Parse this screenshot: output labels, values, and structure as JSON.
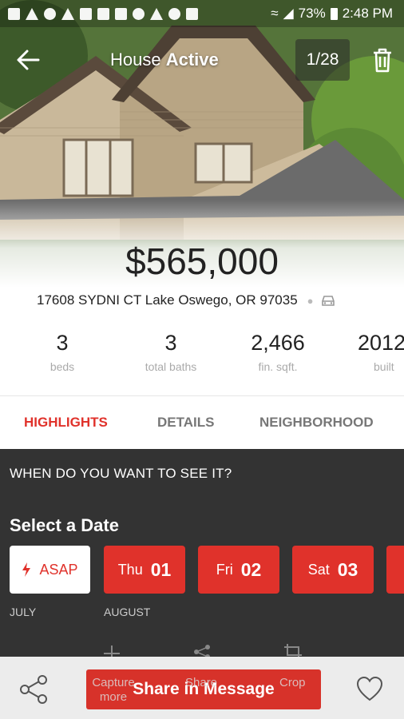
{
  "status_bar": {
    "battery": "73%",
    "time": "2:48 PM"
  },
  "header": {
    "title_prefix": "House",
    "title_status": "Active",
    "photo_counter": "1/28"
  },
  "listing": {
    "price": "$565,000",
    "address": "17608 SYDNI CT  Lake Oswego, OR 97035",
    "stats": [
      {
        "value": "3",
        "label": "beds"
      },
      {
        "value": "3",
        "label": "total baths"
      },
      {
        "value": "2,466",
        "label": "fin. sqft."
      },
      {
        "value": "2012",
        "label": "built"
      }
    ]
  },
  "tabs": [
    {
      "label": "HIGHLIGHTS",
      "active": true
    },
    {
      "label": "DETAILS",
      "active": false
    },
    {
      "label": "NEIGHBORHOOD",
      "active": false
    }
  ],
  "schedule": {
    "question": "WHEN DO YOU WANT TO SEE IT?",
    "heading": "Select a Date",
    "asap_label": "ASAP",
    "dates": [
      {
        "day": "Thu",
        "date": "01"
      },
      {
        "day": "Fri",
        "date": "02"
      },
      {
        "day": "Sat",
        "date": "03"
      }
    ],
    "months": [
      "JULY",
      "AUGUST"
    ]
  },
  "bottom_bar": {
    "share_message_label": "Share in Message",
    "overlay_labels": [
      "Capture more",
      "Share",
      "Crop"
    ]
  },
  "colors": {
    "accent": "#e0322b",
    "panel": "#333333"
  }
}
